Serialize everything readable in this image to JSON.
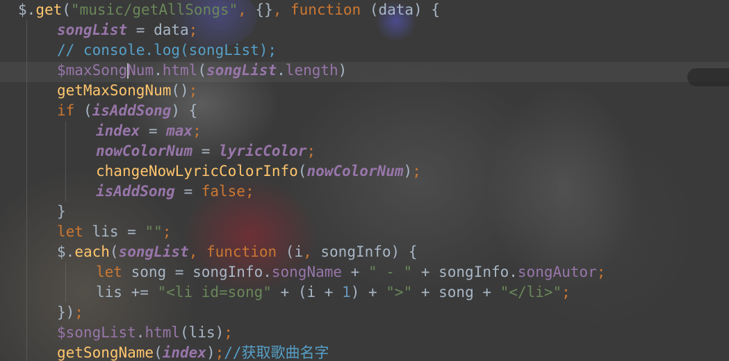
{
  "editor": {
    "language": "javascript",
    "colors": {
      "keyword": "#cc7832",
      "string": "#6a8759",
      "function": "#ffc66d",
      "variable": "#9876aa",
      "number": "#6897bb",
      "comment": "#629755",
      "plain": "#a9b7c6"
    },
    "lines": [
      {
        "indent": 0,
        "tokens": [
          {
            "t": "$",
            "c": "plain"
          },
          {
            "t": ".",
            "c": "plain"
          },
          {
            "t": "get",
            "c": "fn"
          },
          {
            "t": "(",
            "c": "plain"
          },
          {
            "t": "\"music/getAllSongs\"",
            "c": "str"
          },
          {
            "t": ", ",
            "c": "punc"
          },
          {
            "t": "{}",
            "c": "plain"
          },
          {
            "t": ", ",
            "c": "punc"
          },
          {
            "t": "function ",
            "c": "kw"
          },
          {
            "t": "(data) {",
            "c": "plain"
          }
        ]
      },
      {
        "indent": 1,
        "tokens": [
          {
            "t": "songList",
            "c": "var"
          },
          {
            "t": " = data",
            "c": "plain"
          },
          {
            "t": ";",
            "c": "punc"
          }
        ]
      },
      {
        "indent": 1,
        "tokens": [
          {
            "t": "// console.log(songList);",
            "c": "cmt2"
          }
        ]
      },
      {
        "indent": 1,
        "tokens": [
          {
            "t": "$maxSong",
            "c": "prop"
          },
          {
            "t": "CARET",
            "c": "caret"
          },
          {
            "t": "Num",
            "c": "prop"
          },
          {
            "t": ".",
            "c": "plain"
          },
          {
            "t": "html",
            "c": "prop"
          },
          {
            "t": "(",
            "c": "plain"
          },
          {
            "t": "songList",
            "c": "var"
          },
          {
            "t": ".",
            "c": "plain"
          },
          {
            "t": "length",
            "c": "prop"
          },
          {
            "t": ")",
            "c": "plain"
          }
        ]
      },
      {
        "indent": 1,
        "tokens": [
          {
            "t": "getMaxSongNum",
            "c": "fn"
          },
          {
            "t": "()",
            "c": "plain"
          },
          {
            "t": ";",
            "c": "punc"
          }
        ]
      },
      {
        "indent": 1,
        "tokens": [
          {
            "t": "if ",
            "c": "kw"
          },
          {
            "t": "(",
            "c": "plain"
          },
          {
            "t": "isAddSong",
            "c": "var"
          },
          {
            "t": ") {",
            "c": "plain"
          }
        ]
      },
      {
        "indent": 2,
        "tokens": [
          {
            "t": "index",
            "c": "var"
          },
          {
            "t": " = ",
            "c": "plain"
          },
          {
            "t": "max",
            "c": "var"
          },
          {
            "t": ";",
            "c": "punc"
          }
        ]
      },
      {
        "indent": 2,
        "tokens": [
          {
            "t": "nowColorNum",
            "c": "var"
          },
          {
            "t": " = ",
            "c": "plain"
          },
          {
            "t": "lyricColor",
            "c": "var"
          },
          {
            "t": ";",
            "c": "punc"
          }
        ]
      },
      {
        "indent": 2,
        "tokens": [
          {
            "t": "changeNowLyricColorInfo",
            "c": "fn"
          },
          {
            "t": "(",
            "c": "plain"
          },
          {
            "t": "nowColorNum",
            "c": "var"
          },
          {
            "t": ")",
            "c": "plain"
          },
          {
            "t": ";",
            "c": "punc"
          }
        ]
      },
      {
        "indent": 2,
        "tokens": [
          {
            "t": "isAddSong",
            "c": "var"
          },
          {
            "t": " = ",
            "c": "plain"
          },
          {
            "t": "false",
            "c": "kw"
          },
          {
            "t": ";",
            "c": "punc"
          }
        ]
      },
      {
        "indent": 1,
        "tokens": [
          {
            "t": "}",
            "c": "plain"
          }
        ]
      },
      {
        "indent": 1,
        "tokens": [
          {
            "t": "let ",
            "c": "kw"
          },
          {
            "t": "lis = ",
            "c": "plain"
          },
          {
            "t": "\"\"",
            "c": "str"
          },
          {
            "t": ";",
            "c": "punc"
          }
        ]
      },
      {
        "indent": 1,
        "tokens": [
          {
            "t": "$",
            "c": "plain"
          },
          {
            "t": ".",
            "c": "plain"
          },
          {
            "t": "each",
            "c": "fn"
          },
          {
            "t": "(",
            "c": "plain"
          },
          {
            "t": "songList",
            "c": "var"
          },
          {
            "t": ", ",
            "c": "punc"
          },
          {
            "t": "function ",
            "c": "kw"
          },
          {
            "t": "(i",
            "c": "plain"
          },
          {
            "t": ", ",
            "c": "punc"
          },
          {
            "t": "songInfo) {",
            "c": "plain"
          }
        ]
      },
      {
        "indent": 2,
        "tokens": [
          {
            "t": "let ",
            "c": "kw"
          },
          {
            "t": "song = songInfo.",
            "c": "plain"
          },
          {
            "t": "songName",
            "c": "prop"
          },
          {
            "t": " + ",
            "c": "plain"
          },
          {
            "t": "\" - \"",
            "c": "str"
          },
          {
            "t": " + songInfo.",
            "c": "plain"
          },
          {
            "t": "songAutor",
            "c": "prop"
          },
          {
            "t": ";",
            "c": "punc"
          }
        ]
      },
      {
        "indent": 2,
        "tokens": [
          {
            "t": "lis += ",
            "c": "plain"
          },
          {
            "t": "\"<li id=song\"",
            "c": "str"
          },
          {
            "t": " + (i + ",
            "c": "plain"
          },
          {
            "t": "1",
            "c": "num"
          },
          {
            "t": ") + ",
            "c": "plain"
          },
          {
            "t": "\">\"",
            "c": "str"
          },
          {
            "t": " + song + ",
            "c": "plain"
          },
          {
            "t": "\"</li>\"",
            "c": "str"
          },
          {
            "t": ";",
            "c": "punc"
          }
        ]
      },
      {
        "indent": 1,
        "tokens": [
          {
            "t": "})",
            "c": "plain"
          },
          {
            "t": ";",
            "c": "punc"
          }
        ]
      },
      {
        "indent": 1,
        "tokens": [
          {
            "t": "$songList",
            "c": "prop"
          },
          {
            "t": ".",
            "c": "plain"
          },
          {
            "t": "html",
            "c": "prop"
          },
          {
            "t": "(lis)",
            "c": "plain"
          },
          {
            "t": ";",
            "c": "punc"
          }
        ]
      },
      {
        "indent": 1,
        "tokens": [
          {
            "t": "getSongName",
            "c": "fn"
          },
          {
            "t": "(",
            "c": "plain"
          },
          {
            "t": "index",
            "c": "var"
          },
          {
            "t": ")",
            "c": "plain"
          },
          {
            "t": ";",
            "c": "punc"
          },
          {
            "t": "//获取歌曲名字",
            "c": "cmt2"
          }
        ]
      }
    ]
  }
}
